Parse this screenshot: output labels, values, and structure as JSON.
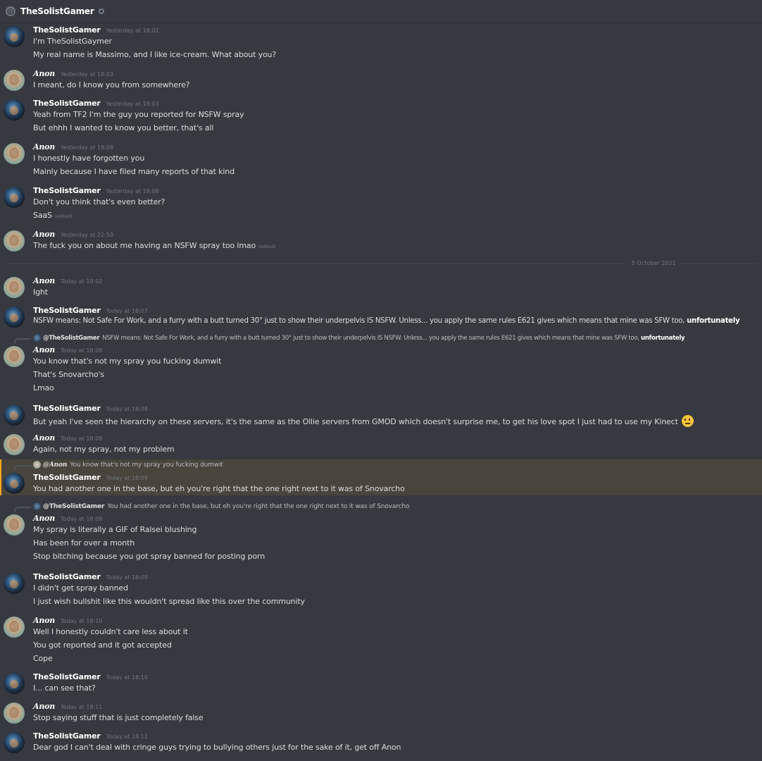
{
  "header": {
    "at_symbol": "@",
    "title": "TheSolistGamer"
  },
  "divider_label": "5 October 2021",
  "messages": [
    {
      "author": "TheSolistGamer",
      "time": "Yesterday at 18:02",
      "lines": [
        "I'm TheSolistGaymer",
        "My real name is Massimo, and I like ice-cream. What about you?"
      ]
    },
    {
      "author": "Anon",
      "time": "Yesterday at 18:03",
      "lines": [
        "I meant, do I know you from somewhere?"
      ]
    },
    {
      "author": "TheSolistGamer",
      "time": "Yesterday at 18:03",
      "lines": [
        "Yeah from TF2 I'm the guy you reported for NSFW spray",
        "But ehhh I wanted to know you better, that's all"
      ]
    },
    {
      "author": "Anon",
      "time": "Yesterday at 18:08",
      "lines": [
        "I honestly have forgotten you",
        "Mainly because I have filed many reports of that kind"
      ]
    },
    {
      "author": "TheSolistGamer",
      "time": "Yesterday at 18:08",
      "lines": [
        "Don't you think that's even better?",
        "SaaS"
      ],
      "edited_label": "(edited)"
    },
    {
      "author": "Anon",
      "time": "Yesterday at 22:50",
      "lines": [
        "The fuck you on about me having an NSFW spray too lmao"
      ],
      "edited_label": "(edited)"
    },
    {
      "author": "Anon",
      "time": "Today at 18:02",
      "lines": [
        "Ight"
      ]
    },
    {
      "author": "TheSolistGamer",
      "time": "Today at 18:07",
      "lines": [
        "NSFW means: Not Safe For Work, and a furry with a butt turned 30° just to show their underpelvis IS NSFW. Unless... you apply the same rules E621 gives which means that mine was SFW too, "
      ],
      "bold_tail": "unfortunately"
    },
    {
      "author": "Anon",
      "time": "Today at 18:08",
      "reply_to": "@TheSolistGamer",
      "reply_text": "NSFW means: Not Safe For Work, and a furry with a butt turned 30° just to show their underpelvis IS NSFW. Unless... you apply the same rules E621 gives which means that mine was SFW too, ",
      "reply_bold": "unfortunately",
      "lines": [
        "You know that's not my spray you fucking dumwit",
        "That's Snovarcho's",
        "Lmao"
      ]
    },
    {
      "author": "TheSolistGamer",
      "time": "Today at 18:08",
      "lines": [
        "But yeah I've seen the hierarchy on these servers, it's the same as the Ollie servers from GMOD which doesn't surprise me, to get his love spot I just had to use my Kinect "
      ],
      "emoji": "neutral-face-emoji"
    },
    {
      "author": "Anon",
      "time": "Today at 18:09",
      "lines": [
        "Again, not my spray, not my problem"
      ]
    },
    {
      "author": "TheSolistGamer",
      "time": "Today at 18:09",
      "reply_to": "@Anon",
      "reply_text": "You know that's not my spray you fucking dumwit",
      "lines": [
        "You had another one in the base, but eh you're right that the one right next to it was of Snovarcho"
      ]
    },
    {
      "author": "Anon",
      "time": "Today at 18:09",
      "reply_to": "@TheSolistGamer",
      "reply_text": "You had another one in the base, but eh you're right that the one right next to it was of Snovarcho",
      "lines": [
        "My spray is literally a GIF of Ralsei blushing",
        "Has been for over a month",
        "Stop bitching because you got spray banned for posting porn"
      ]
    },
    {
      "author": "TheSolistGamer",
      "time": "Today at 18:09",
      "lines": [
        "I didn't get spray banned",
        "I just wish bullshit like this wouldn't spread like this over the community"
      ]
    },
    {
      "author": "Anon",
      "time": "Today at 18:10",
      "lines": [
        "Well I honestly couldn't care less about it",
        "You got reported and it got accepted",
        "Cope"
      ]
    },
    {
      "author": "TheSolistGamer",
      "time": "Today at 18:10",
      "lines": [
        "I... can see that?"
      ]
    },
    {
      "author": "Anon",
      "time": "Today at 18:11",
      "lines": [
        "Stop saying stuff that is just completely false"
      ]
    },
    {
      "author": "TheSolistGamer",
      "time": "Today at 18:11",
      "lines": [
        "Dear god I can't deal with cringe guys trying to bullying others just for the sake of it, get off Anon"
      ]
    }
  ]
}
